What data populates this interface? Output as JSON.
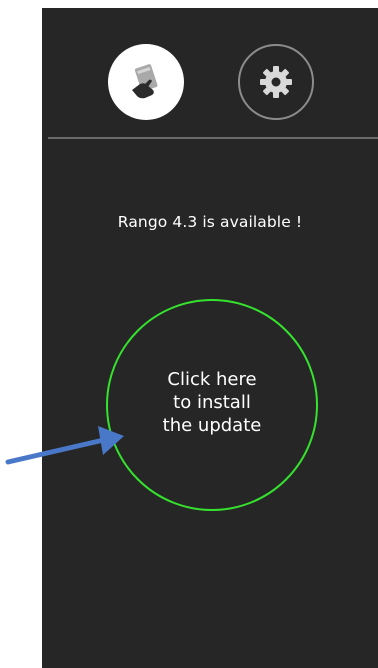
{
  "colors": {
    "panel_background": "#262626",
    "accent_ring": "#35e22e",
    "text": "#ffffff",
    "divider": "#6a6a6a",
    "annotation_arrow": "#4a78c8"
  },
  "top_bar": {
    "home_icon": "hand-card-icon",
    "settings_icon": "gear-icon"
  },
  "update": {
    "status_text": "Rango 4.3 is available !",
    "button_lines": [
      "Click here",
      "to install",
      "the update"
    ]
  }
}
